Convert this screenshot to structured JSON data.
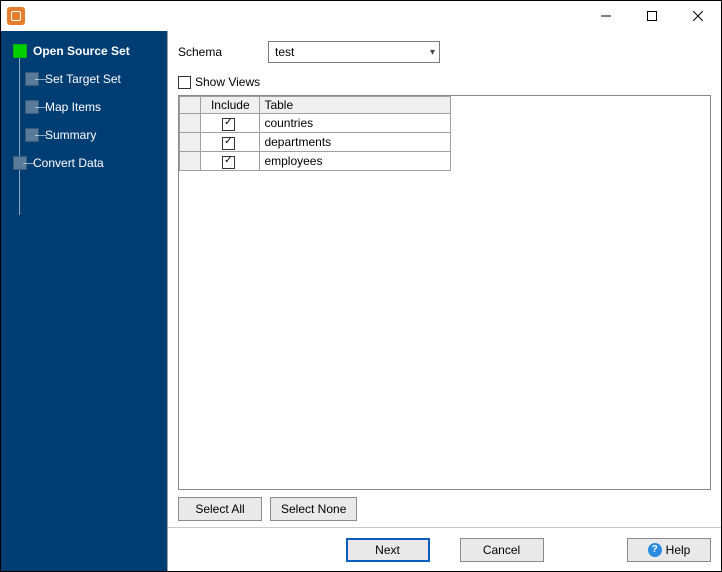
{
  "sidebar": {
    "items": [
      {
        "label": "Open Source Set",
        "active": true,
        "bold": true
      },
      {
        "label": "Set Target Set",
        "active": false,
        "bold": false
      },
      {
        "label": "Map Items",
        "active": false,
        "bold": false
      },
      {
        "label": "Summary",
        "active": false,
        "bold": false
      },
      {
        "label": "Convert Data",
        "active": false,
        "bold": false
      }
    ]
  },
  "main": {
    "schema_label": "Schema",
    "schema_value": "test",
    "show_views_label": "Show Views",
    "show_views_checked": false,
    "grid": {
      "headers": {
        "include": "Include",
        "table": "Table"
      },
      "rows": [
        {
          "include": true,
          "table": "countries"
        },
        {
          "include": true,
          "table": "departments"
        },
        {
          "include": true,
          "table": "employees"
        }
      ]
    },
    "select_all_label": "Select All",
    "select_none_label": "Select None"
  },
  "footer": {
    "next_label": "Next",
    "cancel_label": "Cancel",
    "help_label": "Help"
  }
}
